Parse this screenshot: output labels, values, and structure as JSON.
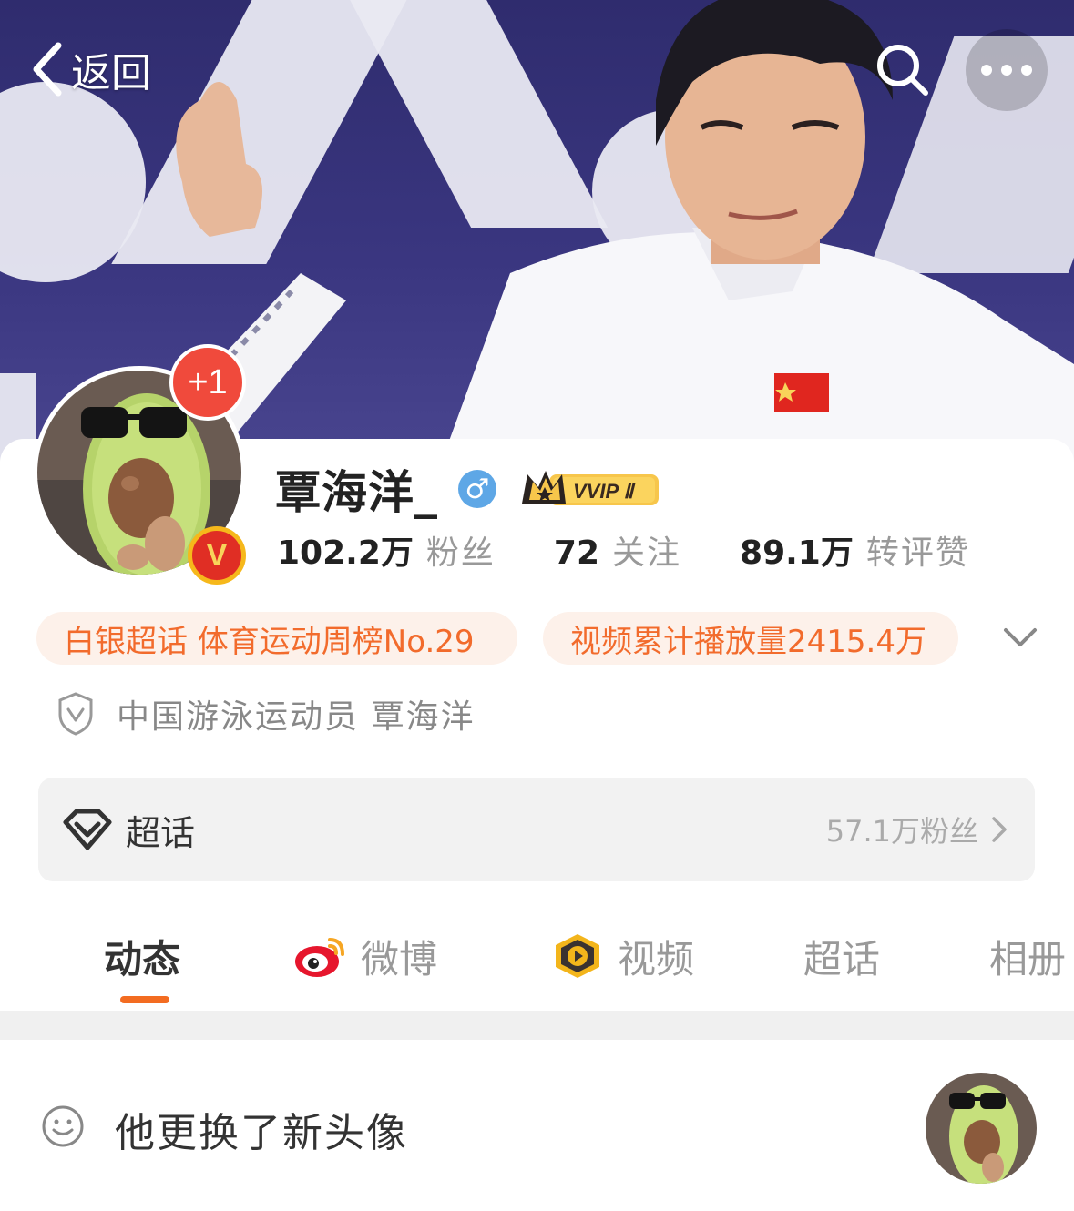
{
  "nav": {
    "back_label": "返回",
    "back_icon": "chevron-left-icon",
    "search_icon": "search-icon",
    "more_icon": "more-dots-icon"
  },
  "profile": {
    "name": "覃海洋_",
    "gender_symbol": "♂",
    "vip_label": "VVIP Ⅱ",
    "plus_badge": "+1",
    "verified_badge": "V",
    "stats": [
      {
        "value": "102.2万",
        "label": "粉丝"
      },
      {
        "value": "72",
        "label": "关注"
      },
      {
        "value": "89.1万",
        "label": "转评赞"
      }
    ],
    "tags": [
      "白银超话 体育运动周榜No.29",
      "视频累计播放量2415.4万"
    ],
    "verification": "中国游泳运动员 覃海洋"
  },
  "supertopic": {
    "title": "超话",
    "fans": "57.1万粉丝"
  },
  "tabs": [
    {
      "label": "动态",
      "active": true,
      "icon": ""
    },
    {
      "label": "微博",
      "active": false,
      "icon": "weibo-icon"
    },
    {
      "label": "视频",
      "active": false,
      "icon": "video-icon"
    },
    {
      "label": "超话",
      "active": false,
      "icon": ""
    },
    {
      "label": "相册",
      "active": false,
      "icon": ""
    }
  ],
  "feed": {
    "text": "他更换了新头像",
    "icon": "smile-icon"
  },
  "colors": {
    "accent": "#f36c21",
    "pill_bg": "#fdf1ea",
    "pill_text": "#f26b2c",
    "plus_badge": "#f04a3c",
    "gender": "#5ea7e6"
  }
}
